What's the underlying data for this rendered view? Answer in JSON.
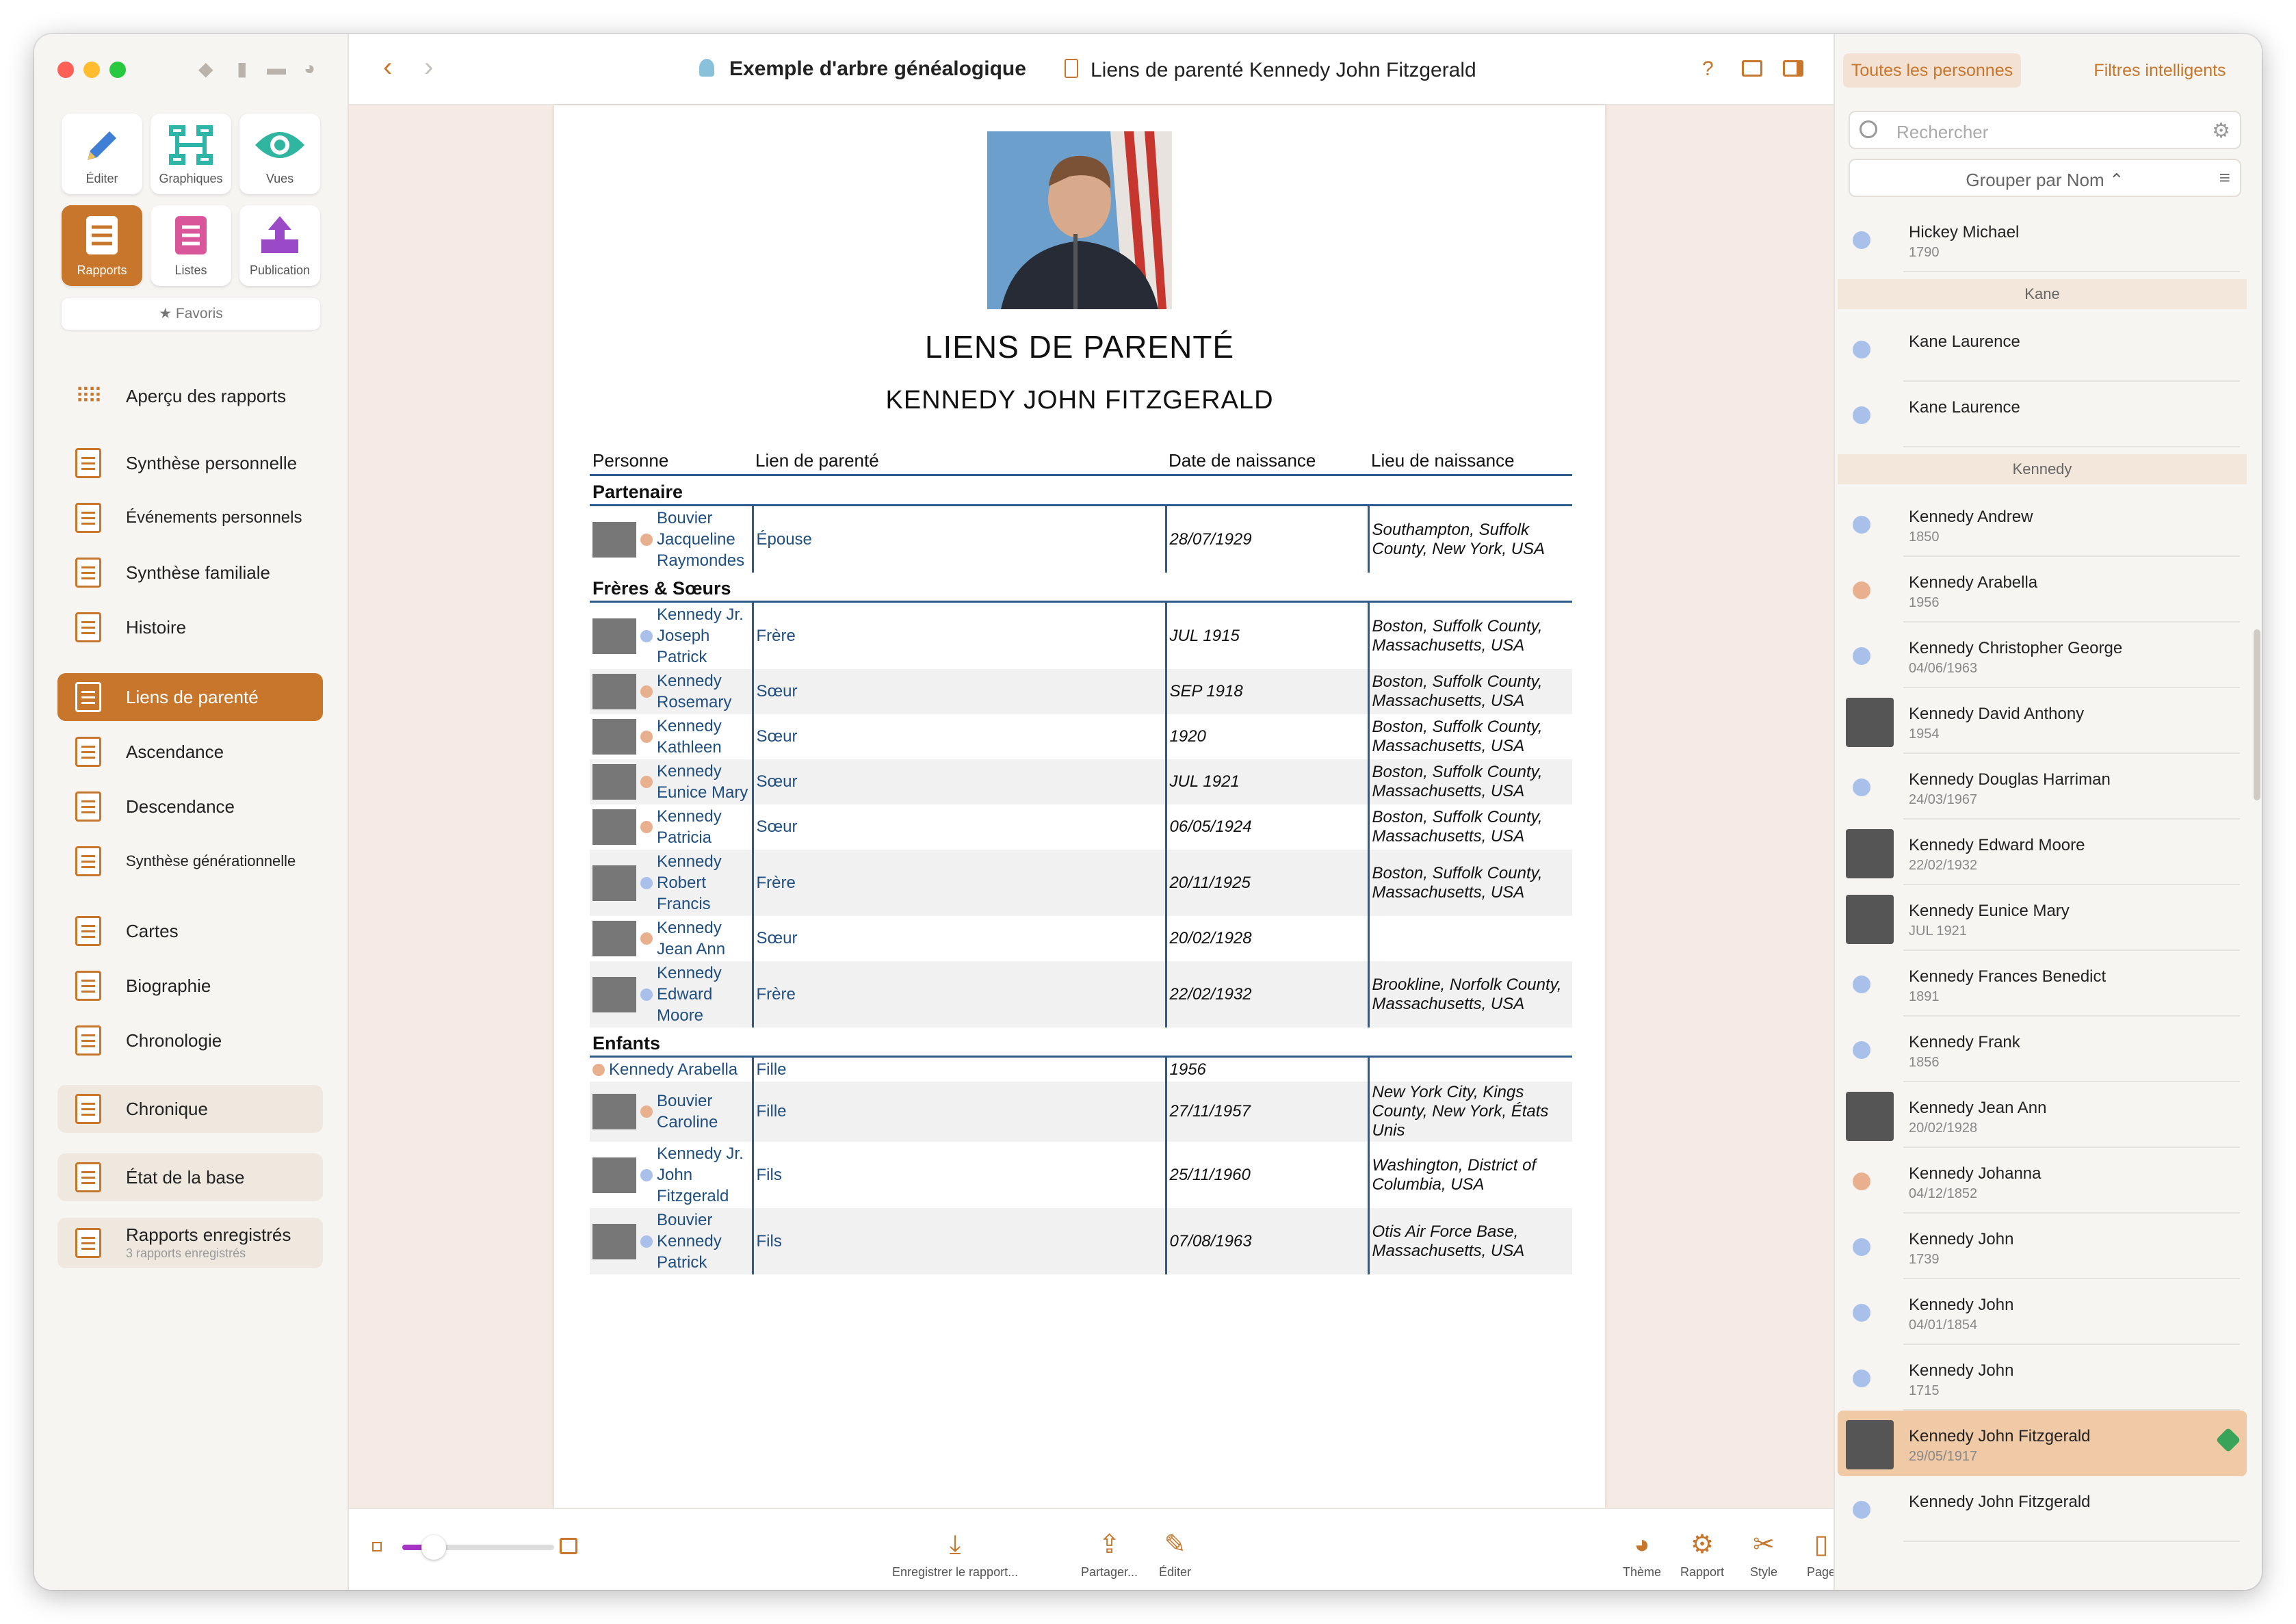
{
  "toolbar": {
    "tree_title": "Exemple d'arbre généalogique",
    "doc_title": "Liens de parenté Kennedy John Fitzgerald",
    "help": "?"
  },
  "sidebar": {
    "tiles": [
      {
        "label": "Éditer"
      },
      {
        "label": "Graphiques"
      },
      {
        "label": "Vues"
      },
      {
        "label": "Rapports"
      },
      {
        "label": "Listes"
      },
      {
        "label": "Publication"
      }
    ],
    "favorites": "Favoris",
    "items": [
      {
        "label": "Aperçu des rapports"
      },
      {
        "label": "Synthèse personnelle"
      },
      {
        "label": "Événements personnels"
      },
      {
        "label": "Synthèse familiale"
      },
      {
        "label": "Histoire"
      },
      {
        "label": "Liens de parenté"
      },
      {
        "label": "Ascendance"
      },
      {
        "label": "Descendance"
      },
      {
        "label": "Synthèse générationnelle"
      },
      {
        "label": "Cartes"
      },
      {
        "label": "Biographie"
      },
      {
        "label": "Chronologie"
      },
      {
        "label": "Chronique"
      },
      {
        "label": "État de la base"
      },
      {
        "label": "Rapports enregistrés",
        "sub": "3 rapports enregistrés"
      }
    ]
  },
  "report": {
    "title": "LIENS DE PARENTÉ",
    "subtitle": "KENNEDY JOHN FITZGERALD",
    "headers": [
      "Personne",
      "Lien de parenté",
      "Date de naissance",
      "Lieu de naissance"
    ],
    "groups": [
      {
        "name": "Partenaire",
        "rows": [
          {
            "person": "Bouvier Jacqueline Raymondes",
            "rel": "Épouse",
            "date": "28/07/1929",
            "place": "Southampton, Suffolk County, New York, USA",
            "g": "f",
            "photo": true
          }
        ]
      },
      {
        "name": "Frères & Sœurs",
        "rows": [
          {
            "person": "Kennedy Jr. Joseph Patrick",
            "rel": "Frère",
            "date": "JUL 1915",
            "place": "Boston, Suffolk County, Massachusetts, USA",
            "g": "m",
            "photo": true
          },
          {
            "person": "Kennedy Rosemary",
            "rel": "Sœur",
            "date": "SEP 1918",
            "place": "Boston, Suffolk County, Massachusetts, USA",
            "g": "f",
            "photo": true
          },
          {
            "person": "Kennedy Kathleen",
            "rel": "Sœur",
            "date": "1920",
            "place": "Boston, Suffolk County, Massachusetts, USA",
            "g": "f",
            "photo": true
          },
          {
            "person": "Kennedy Eunice Mary",
            "rel": "Sœur",
            "date": "JUL 1921",
            "place": "Boston, Suffolk County, Massachusetts, USA",
            "g": "f",
            "photo": true
          },
          {
            "person": "Kennedy Patricia",
            "rel": "Sœur",
            "date": "06/05/1924",
            "place": "Boston, Suffolk County, Massachusetts, USA",
            "g": "f",
            "photo": true
          },
          {
            "person": "Kennedy Robert Francis",
            "rel": "Frère",
            "date": "20/11/1925",
            "place": "Boston, Suffolk County, Massachusetts, USA",
            "g": "m",
            "photo": true
          },
          {
            "person": "Kennedy Jean Ann",
            "rel": "Sœur",
            "date": "20/02/1928",
            "place": "",
            "g": "f",
            "photo": true
          },
          {
            "person": "Kennedy Edward Moore",
            "rel": "Frère",
            "date": "22/02/1932",
            "place": "Brookline, Norfolk County, Massachusetts, USA",
            "g": "m",
            "photo": true
          }
        ]
      },
      {
        "name": "Enfants",
        "rows": [
          {
            "person": "Kennedy Arabella",
            "rel": "Fille",
            "date": "1956",
            "place": "",
            "g": "f",
            "photo": false
          },
          {
            "person": "Bouvier Caroline",
            "rel": "Fille",
            "date": "27/11/1957",
            "place": "New York City, Kings County, New York, États Unis",
            "g": "f",
            "photo": true
          },
          {
            "person": "Kennedy Jr. John Fitzgerald",
            "rel": "Fils",
            "date": "25/11/1960",
            "place": "Washington, District of Columbia, USA",
            "g": "m",
            "photo": true
          },
          {
            "person": "Bouvier Kennedy Patrick",
            "rel": "Fils",
            "date": "07/08/1963",
            "place": "Otis Air Force Base, Massachusetts, USA",
            "g": "m",
            "photo": true
          }
        ]
      }
    ]
  },
  "bottom": {
    "buttons": [
      "Enregistrer le rapport...",
      "Partager...",
      "Éditer"
    ],
    "right": [
      "Thème",
      "Rapport",
      "Style",
      "Page"
    ]
  },
  "right": {
    "tabs": [
      "Toutes les personnes",
      "Filtres intelligents"
    ],
    "search_placeholder": "Rechercher",
    "group_by": "Grouper par Nom ⌃",
    "entries": [
      {
        "type": "person",
        "name": "Hickey Michael",
        "date": "1790",
        "g": "m"
      },
      {
        "type": "section",
        "name": "Kane"
      },
      {
        "type": "person",
        "name": "Kane Laurence",
        "date": "",
        "g": "m"
      },
      {
        "type": "person",
        "name": "Kane Laurence",
        "date": "",
        "g": "m"
      },
      {
        "type": "section",
        "name": "Kennedy"
      },
      {
        "type": "person",
        "name": "Kennedy Andrew",
        "date": "1850",
        "g": "m"
      },
      {
        "type": "person",
        "name": "Kennedy Arabella",
        "date": "1956",
        "g": "f"
      },
      {
        "type": "person",
        "name": "Kennedy Christopher George",
        "date": "04/06/1963",
        "g": "m"
      },
      {
        "type": "person",
        "name": "Kennedy David Anthony",
        "date": "1954",
        "g": "m",
        "photo": true
      },
      {
        "type": "person",
        "name": "Kennedy Douglas Harriman",
        "date": "24/03/1967",
        "g": "m"
      },
      {
        "type": "person",
        "name": "Kennedy Edward Moore",
        "date": "22/02/1932",
        "g": "m",
        "photo": true
      },
      {
        "type": "person",
        "name": "Kennedy Eunice Mary",
        "date": "JUL 1921",
        "g": "f",
        "photo": true
      },
      {
        "type": "person",
        "name": "Kennedy Frances Benedict",
        "date": "1891",
        "g": "m"
      },
      {
        "type": "person",
        "name": "Kennedy Frank",
        "date": "1856",
        "g": "m"
      },
      {
        "type": "person",
        "name": "Kennedy Jean Ann",
        "date": "20/02/1928",
        "g": "f",
        "photo": true
      },
      {
        "type": "person",
        "name": "Kennedy Johanna",
        "date": "04/12/1852",
        "g": "f"
      },
      {
        "type": "person",
        "name": "Kennedy John",
        "date": "1739",
        "g": "m"
      },
      {
        "type": "person",
        "name": "Kennedy John",
        "date": "04/01/1854",
        "g": "m"
      },
      {
        "type": "person",
        "name": "Kennedy John",
        "date": "1715",
        "g": "m"
      },
      {
        "type": "person",
        "name": "Kennedy John Fitzgerald",
        "date": "29/05/1917",
        "g": "m",
        "photo": true,
        "selected": true
      },
      {
        "type": "person",
        "name": "Kennedy John Fitzgerald",
        "date": "",
        "g": "m"
      }
    ]
  },
  "colors": {
    "accent": "#c7762b",
    "male": "#a9c0ea",
    "female": "#e9b08f",
    "table_blue": "#2f5b8a"
  }
}
